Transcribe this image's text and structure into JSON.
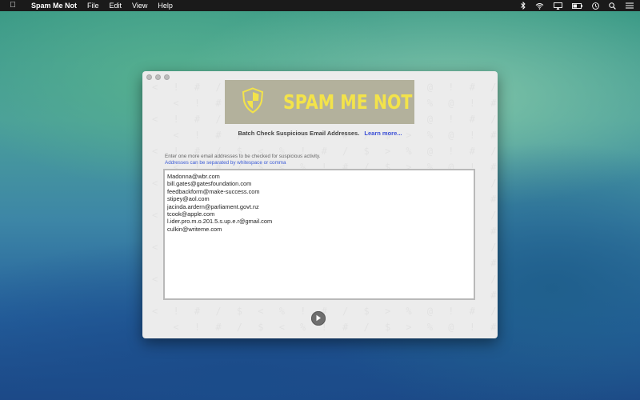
{
  "menubar": {
    "app_name": "Spam Me Not",
    "menus": [
      "File",
      "Edit",
      "View",
      "Help"
    ]
  },
  "status_icons": [
    "bluetooth-icon",
    "wifi-icon",
    "airplay-icon",
    "battery-icon",
    "clock-icon",
    "search-icon",
    "list-icon"
  ],
  "window": {
    "brand": "SPAM ME NOT",
    "tagline": "Batch Check Suspicious Email Addresses.",
    "learn_more": "Learn more...",
    "instructions": "Enter one more email addresses to be checked for suspicious activity.",
    "hint": "Addresses can be separated by whitespace or comma",
    "emails": [
      "Madonna@wbr.com",
      "bill.gates@gatesfoundation.com",
      "feedbackform@make-success.com",
      "stipey@aol.com",
      "jacinda.ardern@parliament.govt.nz",
      "tcook@apple.com",
      "l.ider.pro.m.o.201.5.s.up.e.r@gmail.com",
      "culkin@writeme.com"
    ],
    "watermark_text": "< ! # / $ < % ! # / $ > % @ ! # / $ > % ! #"
  },
  "colors": {
    "banner_bg": "#b3b19c",
    "brand_yellow": "#f3e34a",
    "link_blue": "#3b4fd6"
  }
}
